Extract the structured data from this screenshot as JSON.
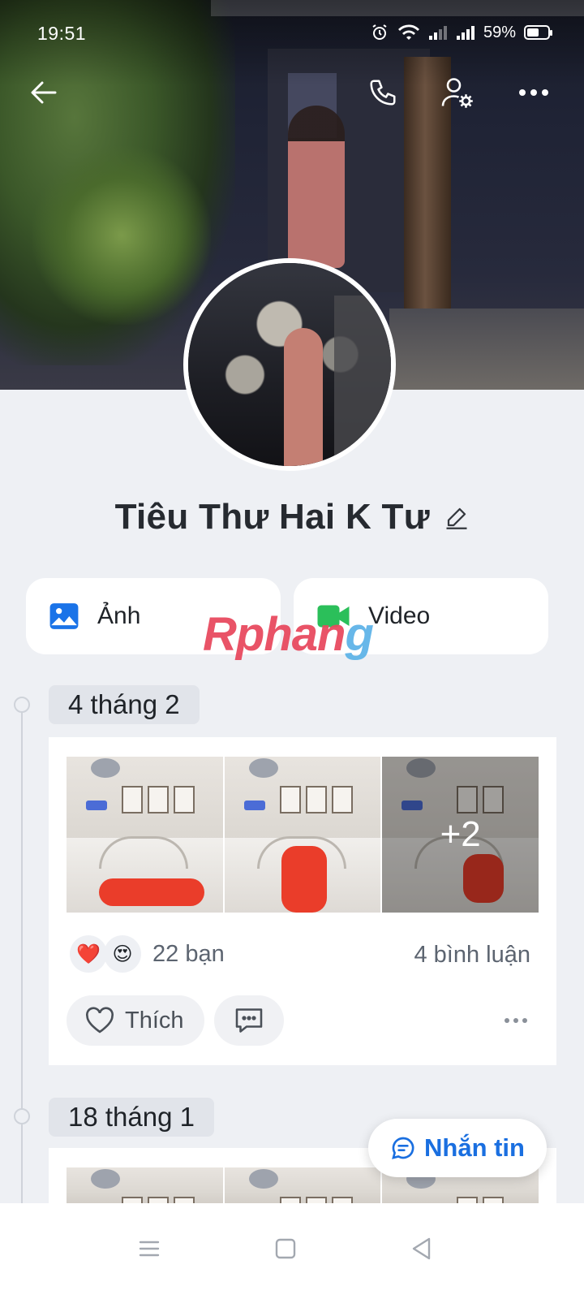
{
  "status_bar": {
    "time": "19:51",
    "battery_text": "59%",
    "battery_level": 0.59
  },
  "profile": {
    "name": "Tiêu Thư Hai K Tư"
  },
  "media_tabs": {
    "photos_label": "Ảnh",
    "video_label": "Video"
  },
  "watermark": {
    "text_a": "Rphan",
    "text_b": "g"
  },
  "timeline": [
    {
      "date": "4 tháng 2",
      "extra_photos": "+2",
      "reactions": [
        "❤️",
        "😍"
      ],
      "friends_text": "22 bạn",
      "comments_text": "4 bình luận",
      "like_label": "Thích"
    },
    {
      "date": "18 tháng 1"
    }
  ],
  "fab": {
    "message_label": "Nhắn tin"
  },
  "colors": {
    "accent": "#1a6fe0",
    "photo_icon": "#1a73e8",
    "video_icon": "#2bbf5a"
  },
  "icons": [
    "back-arrow-icon",
    "phone-icon",
    "user-settings-icon",
    "more-icon",
    "edit-icon",
    "image-icon",
    "video-camera-icon",
    "heart-icon",
    "comment-icon",
    "chat-icon",
    "menu-icon",
    "home-square-icon",
    "back-triangle-icon"
  ]
}
